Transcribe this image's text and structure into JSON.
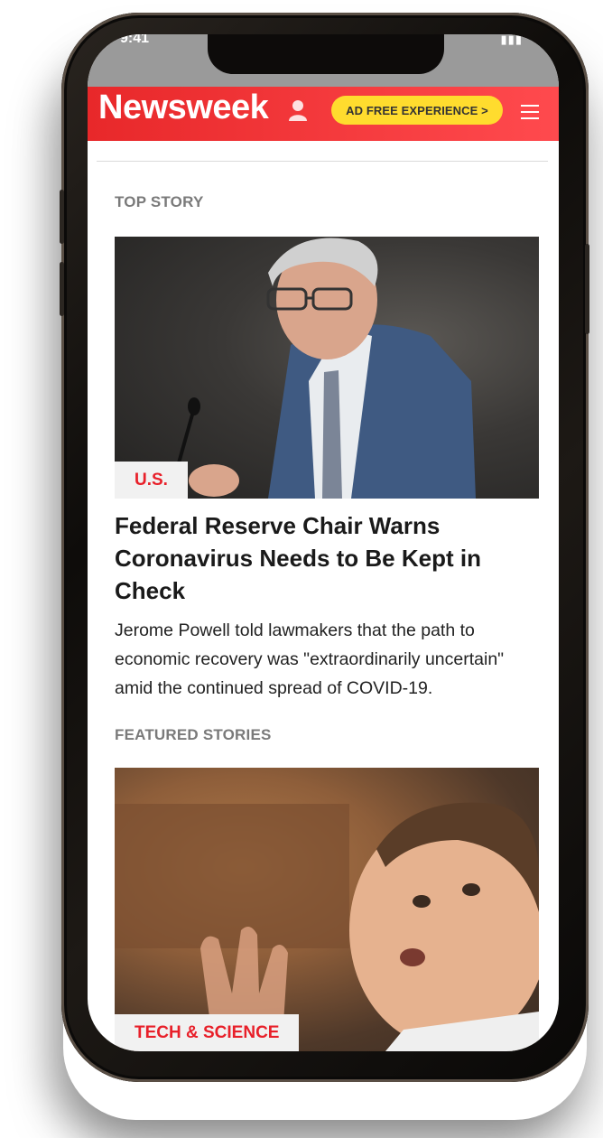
{
  "header": {
    "logo": "Newsweek",
    "ad_button_label": "AD FREE EXPERIENCE >",
    "brand_color": "#e8282a",
    "ad_button_color": "#ffdc2e"
  },
  "icons": {
    "user": "user-icon",
    "menu": "hamburger-menu-icon"
  },
  "top_story": {
    "section_label": "TOP STORY",
    "category": "U.S.",
    "headline": "Federal Reserve Chair Warns Coronavirus Needs to Be Kept in Check",
    "summary": "Jerome Powell told lawmakers that the path to economic recovery was \"extraordinarily uncertain\" amid the continued spread of COVID-19."
  },
  "featured": {
    "section_label": "FEATURED STORIES",
    "category": "TECH & SCIENCE"
  }
}
